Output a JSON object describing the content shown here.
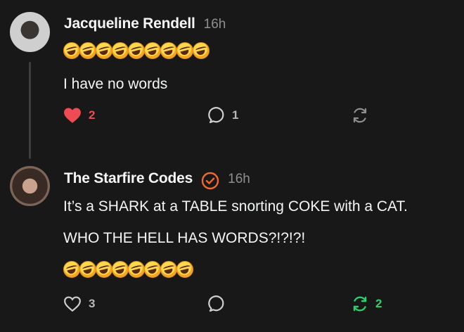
{
  "posts": [
    {
      "username": "Jacqueline Rendell",
      "timestamp": "16h",
      "emoji_count": 9,
      "text": [
        "I have no words"
      ],
      "actions": {
        "like": {
          "count": "2",
          "liked": true,
          "color": "#ef4b55"
        },
        "reply": {
          "count": "1"
        },
        "repost": {
          "count": "",
          "reposted": false
        }
      }
    },
    {
      "username": "The Starfire Codes",
      "timestamp": "16h",
      "verified": true,
      "verified_color": "#f06a2a",
      "emoji_count": 8,
      "text": [
        "It’s a SHARK at a TABLE snorting COKE with a CAT.",
        "WHO THE HELL HAS WORDS?!?!?!"
      ],
      "actions": {
        "like": {
          "count": "3",
          "liked": false
        },
        "reply": {
          "count": ""
        },
        "repost": {
          "count": "2",
          "reposted": true,
          "color": "#2ecf6c"
        }
      }
    }
  ],
  "icons": [
    "heart-icon",
    "comment-icon",
    "repost-icon",
    "verified-badge-icon",
    "rolling-laughing-emoji"
  ]
}
